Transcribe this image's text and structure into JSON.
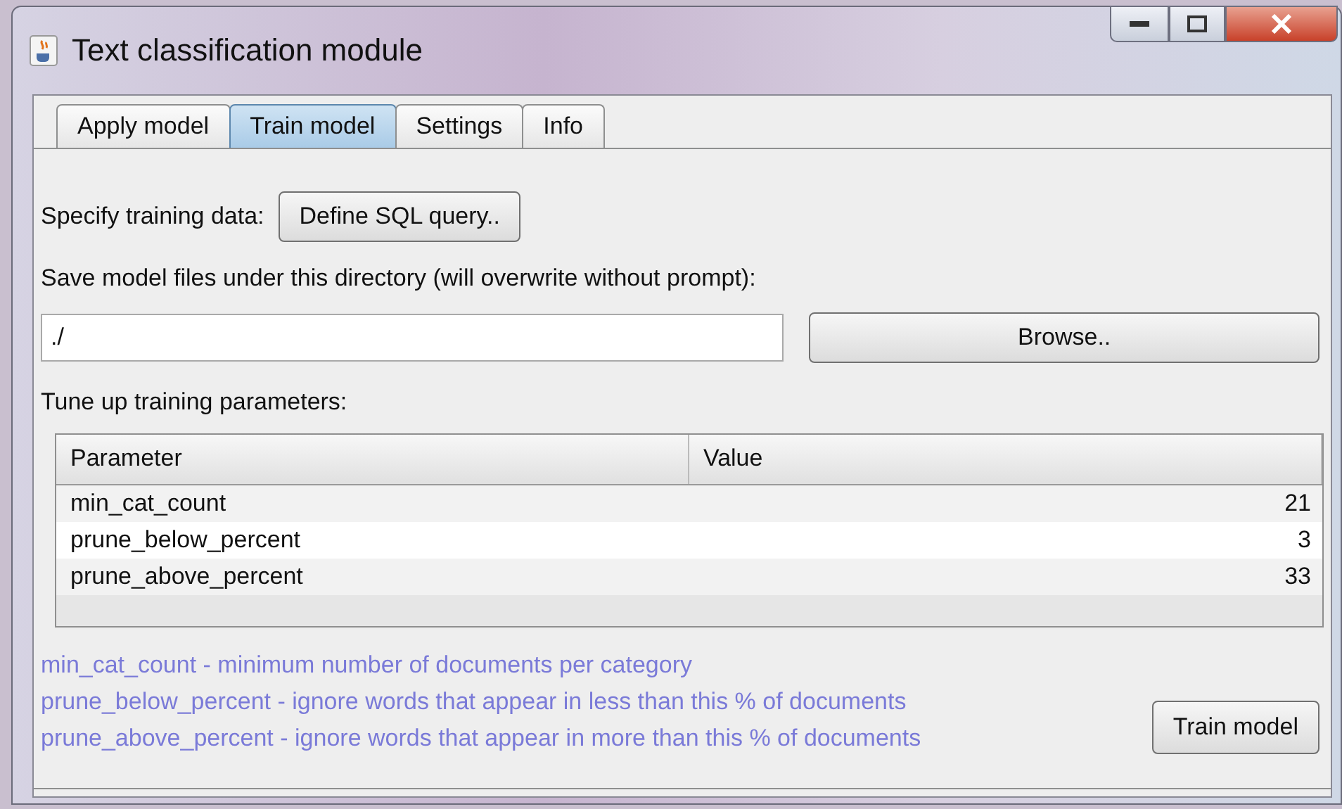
{
  "window": {
    "title": "Text classification module"
  },
  "tabs": [
    {
      "label": "Apply model",
      "selected": false
    },
    {
      "label": "Train model",
      "selected": true
    },
    {
      "label": "Settings",
      "selected": false
    },
    {
      "label": "Info",
      "selected": false
    }
  ],
  "training_data": {
    "label": "Specify training data:",
    "button": "Define SQL query.."
  },
  "directory": {
    "label": "Save model files under this directory (will overwrite without prompt):",
    "value": "./",
    "button": "Browse.."
  },
  "parameters_label": "Tune up training parameters:",
  "table": {
    "columns": [
      "Parameter",
      "Value"
    ],
    "rows": [
      {
        "parameter": "min_cat_count",
        "value": "21"
      },
      {
        "parameter": "prune_below_percent",
        "value": "3"
      },
      {
        "parameter": "prune_above_percent",
        "value": "33"
      }
    ]
  },
  "help_lines": [
    "min_cat_count - minimum number of documents per category",
    "prune_below_percent - ignore words that appear in less than this % of documents",
    "prune_above_percent - ignore words that appear in more than this % of documents"
  ],
  "train_button": "Train model"
}
